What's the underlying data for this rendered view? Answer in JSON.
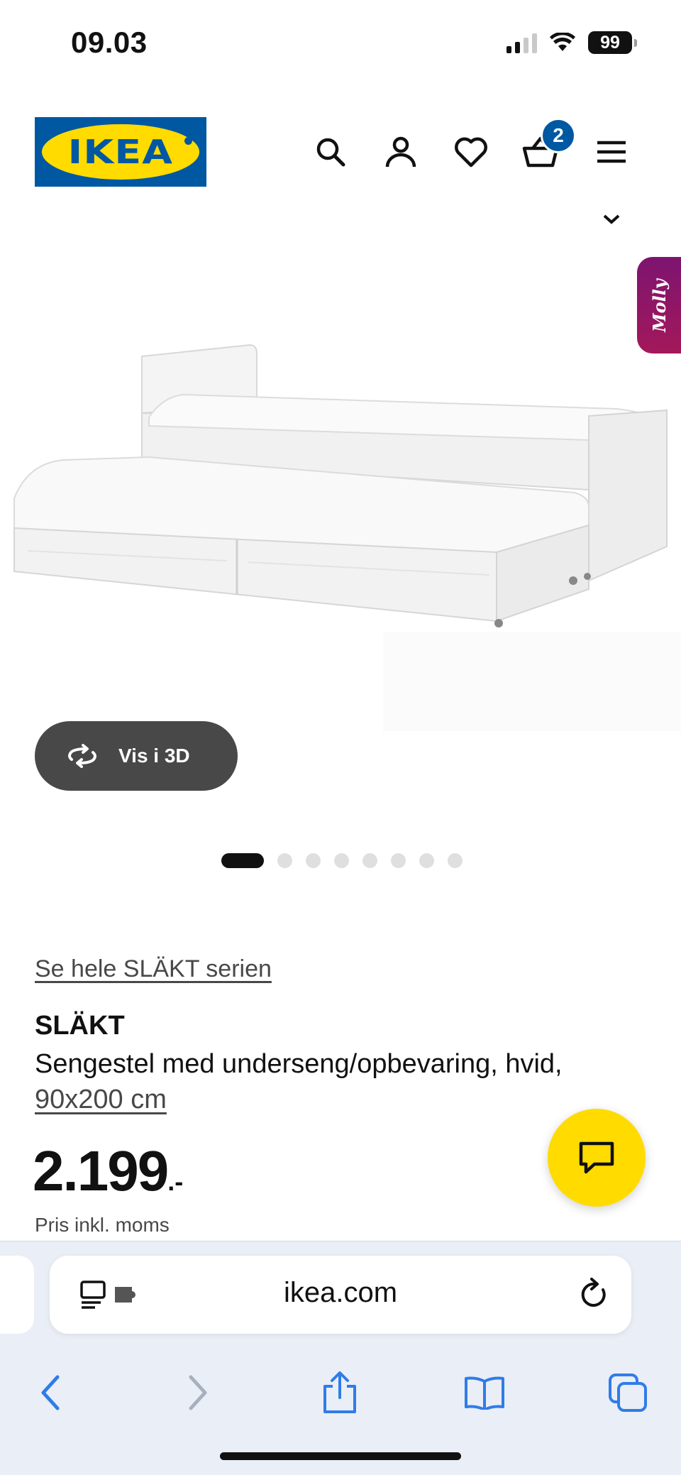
{
  "status_bar": {
    "time": "09.03",
    "battery": "99"
  },
  "header": {
    "logo_text": "IKEA",
    "icons": [
      "search-icon",
      "user-icon",
      "heart-icon",
      "cart-icon",
      "menu-icon"
    ],
    "cart_count": "2"
  },
  "side_tab": {
    "label": "Molly"
  },
  "viewer": {
    "button_label": "Vis i 3D",
    "total_images": 8,
    "active_index": 0
  },
  "product": {
    "series_link": "Se hele SLÄKT serien",
    "name": "SLÄKT",
    "description": "Sengestel med underseng/opbevaring, hvid,",
    "size": "90x200 cm",
    "price": "2.199",
    "price_suffix": ".-",
    "price_note": "Pris inkl. moms"
  },
  "browser": {
    "url": "ikea.com",
    "toolbar": [
      "back-icon",
      "forward-icon",
      "share-icon",
      "bookmarks-icon",
      "tabs-icon"
    ]
  },
  "colors": {
    "ikea_blue": "#0058a3",
    "ikea_yellow": "#ffdb00",
    "molly_purple": "#8a1566",
    "ios_blue": "#2f7ce8"
  }
}
